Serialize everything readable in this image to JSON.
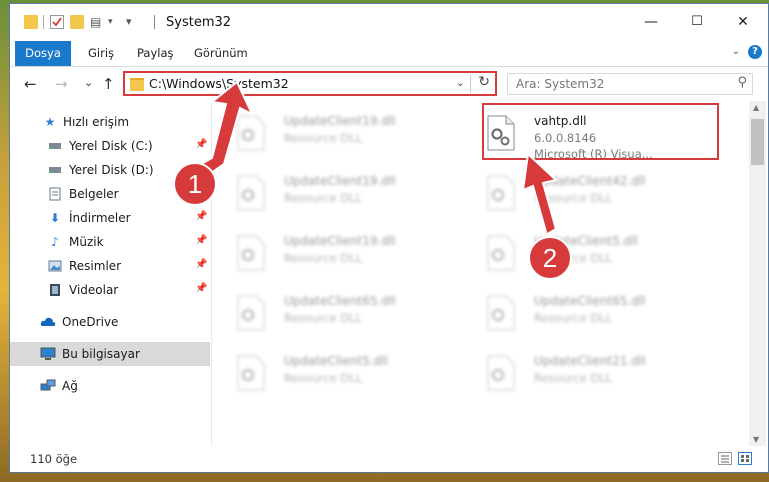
{
  "window": {
    "title": "System32",
    "controls": [
      "—",
      "☐",
      "✕"
    ]
  },
  "ribbon": {
    "tabs": [
      "Dosya",
      "Giriş",
      "Paylaş",
      "Görünüm"
    ],
    "help": "?"
  },
  "navigation": {
    "back": "←",
    "forward": "→",
    "recent": "⌄",
    "up": "↑",
    "address": "C:\\Windows\\System32",
    "search_placeholder": "Ara: System32"
  },
  "sidebar": {
    "items": [
      {
        "label": "Hızlı erişim",
        "icon": "star-icon",
        "pinned": false
      },
      {
        "label": "Yerel Disk (C:)",
        "icon": "drive-icon",
        "pinned": true
      },
      {
        "label": "Yerel Disk (D:)",
        "icon": "drive-icon",
        "pinned": true
      },
      {
        "label": "Belgeler",
        "icon": "documents-icon",
        "pinned": true
      },
      {
        "label": "İndirmeler",
        "icon": "download-icon",
        "pinned": true
      },
      {
        "label": "Müzik",
        "icon": "music-icon",
        "pinned": true
      },
      {
        "label": "Resimler",
        "icon": "pictures-icon",
        "pinned": true
      },
      {
        "label": "Videolar",
        "icon": "video-icon",
        "pinned": true
      },
      {
        "label": "OneDrive",
        "icon": "cloud-icon",
        "pinned": false
      },
      {
        "label": "Bu bilgisayar",
        "icon": "computer-icon",
        "pinned": false,
        "selected": true
      },
      {
        "label": "Ağ",
        "icon": "network-icon",
        "pinned": false
      }
    ]
  },
  "files": {
    "left": [
      {
        "name": "UpdateClient19.dll",
        "type": "Resource DLL"
      },
      {
        "name": "UpdateClient19.dll",
        "type": "Resource DLL"
      },
      {
        "name": "UpdateClient19.dll",
        "type": "Resource DLL"
      },
      {
        "name": "UpdateClient65.dll",
        "type": "Resource DLL"
      },
      {
        "name": "UpdateClient5.dll",
        "type": "Resource DLL"
      }
    ],
    "right": [
      {
        "name": "vahtp.dll",
        "version": "6.0.0.8146",
        "company": "Microsoft (R) Visua..."
      },
      {
        "name": "UpdateClient42.dll",
        "type": "Resource DLL"
      },
      {
        "name": "UpdateClient5.dll",
        "type": "Resource DLL"
      },
      {
        "name": "UpdateClient65.dll",
        "type": "Resource DLL"
      },
      {
        "name": "UpdateClient21.dll",
        "type": "Resource DLL"
      }
    ]
  },
  "status": {
    "count": "110 öğe"
  },
  "annotations": {
    "marker1": "1",
    "marker2": "2",
    "color": "#d73a3a"
  }
}
